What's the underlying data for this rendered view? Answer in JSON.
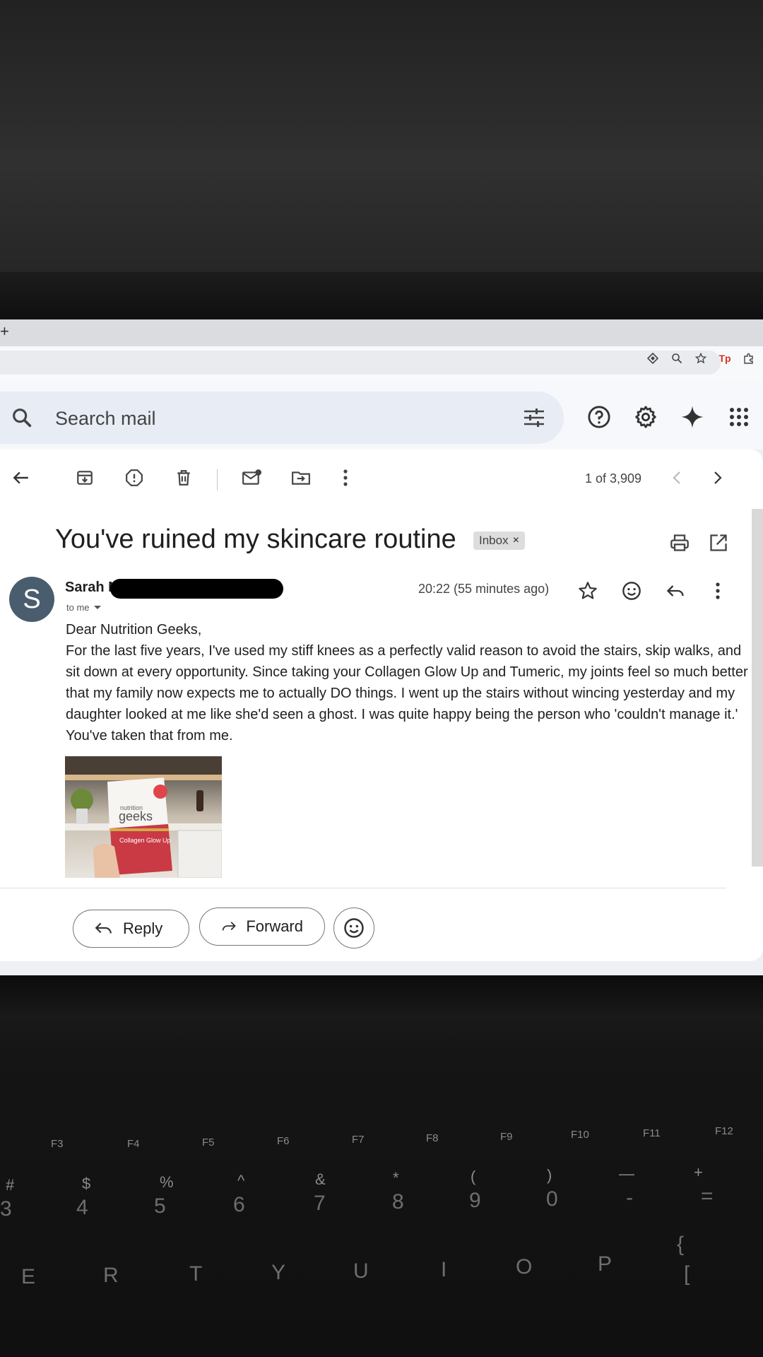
{
  "browser": {
    "new_tab_label": "+",
    "omnibox_icons": [
      "translate-icon",
      "zoom-icon",
      "bookmark-star-icon",
      "tp-extension-icon",
      "extensions-puzzle-icon"
    ],
    "extension_label": "Tp"
  },
  "gmail": {
    "search": {
      "placeholder": "Search mail"
    },
    "top_icons": [
      "help-icon",
      "settings-gear-icon",
      "gemini-sparkle-icon",
      "apps-grid-icon"
    ]
  },
  "toolbar": {
    "icons": [
      "back-arrow-icon",
      "archive-icon",
      "report-spam-icon",
      "delete-icon",
      "mark-unread-icon",
      "move-to-icon",
      "more-vert-icon"
    ],
    "pager_text": "1 of 3,909"
  },
  "email": {
    "subject": "You've ruined my skincare routine",
    "label": "Inbox",
    "label_close": "×",
    "avatar_letter": "S",
    "sender_name": "Sarah N",
    "recipient": "to me",
    "timestamp": "20:22 (55 minutes ago)",
    "greeting": "Dear Nutrition Geeks,",
    "body": "For the last five years, I've used my stiff knees as a perfectly valid reason to avoid the stairs, skip walks, and sit down at every opportunity. Since taking your Collagen Glow Up and Tumeric, my joints feel so much better that my family now expects me to actually DO things. I went up the stairs without wincing yesterday and my daughter looked at me like she'd seen a ghost. I was quite happy being the person who 'couldn't manage it.' You've taken that from me.",
    "attachment": {
      "brand_line1": "nutrition",
      "brand_line2": "geeks",
      "product": "Collagen Glow Up"
    }
  },
  "actions": {
    "reply_label": "Reply",
    "forward_label": "Forward"
  },
  "keyboard": {
    "fn_keys": [
      "F3",
      "F4",
      "F5",
      "F6",
      "F7",
      "F8",
      "F9",
      "F10",
      "F11",
      "F12"
    ],
    "symbols": [
      "#",
      "$",
      "%",
      "^",
      "&",
      "*",
      "(",
      ")",
      "—",
      "+"
    ],
    "numbers": [
      "3",
      "4",
      "5",
      "6",
      "7",
      "8",
      "9",
      "0",
      "-",
      "="
    ],
    "letters": [
      "E",
      "R",
      "T",
      "Y",
      "U",
      "I",
      "O",
      "P",
      "{",
      "["
    ]
  }
}
